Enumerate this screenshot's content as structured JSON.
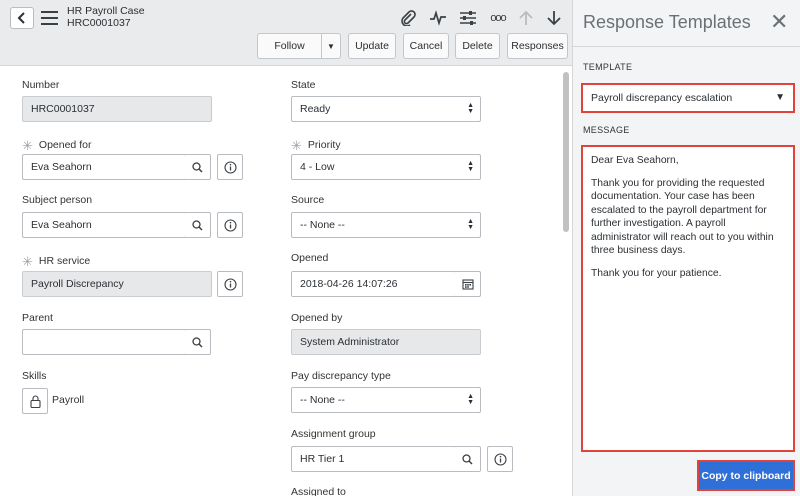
{
  "header": {
    "title": "HR Payroll Case",
    "number": "HRC0001037",
    "buttons": {
      "follow": "Follow",
      "update": "Update",
      "cancel": "Cancel",
      "delete": "Delete",
      "responses": "Responses"
    },
    "icons": [
      "back-icon",
      "menu-icon",
      "attachment-icon",
      "activity-icon",
      "settings-sliders-icon",
      "more-icon",
      "arrow-up-icon",
      "arrow-down-icon"
    ]
  },
  "form": {
    "number": {
      "label": "Number",
      "value": "HRC0001037"
    },
    "opened_for": {
      "label": "Opened for",
      "value": "Eva Seahorn"
    },
    "subject_person": {
      "label": "Subject person",
      "value": "Eva Seahorn"
    },
    "hr_service": {
      "label": "HR service",
      "value": "Payroll Discrepancy"
    },
    "parent": {
      "label": "Parent",
      "value": ""
    },
    "skills": {
      "label": "Skills",
      "value": "Payroll"
    },
    "state": {
      "label": "State",
      "value": "Ready"
    },
    "priority": {
      "label": "Priority",
      "value": "4 - Low"
    },
    "source": {
      "label": "Source",
      "value": "-- None --"
    },
    "opened": {
      "label": "Opened",
      "value": "2018-04-26 14:07:26"
    },
    "opened_by": {
      "label": "Opened by",
      "value": "System Administrator"
    },
    "pay_discrepancy_type": {
      "label": "Pay discrepancy type",
      "value": "-- None --"
    },
    "assignment_group": {
      "label": "Assignment group",
      "value": "HR Tier 1"
    },
    "assigned_to": {
      "label": "Assigned to"
    }
  },
  "panel": {
    "title": "Response Templates",
    "template_label": "TEMPLATE",
    "template_value": "Payroll discrepancy escalation",
    "message_label": "MESSAGE",
    "message": {
      "greeting": "Dear Eva Seahorn,",
      "body": "Thank you for providing the requested documentation. Your case has been escalated to the payroll department for further investigation. A payroll administrator will reach out to you within three business days.",
      "closing": "Thank you for your patience."
    },
    "copy_button": "Copy to clipboard"
  },
  "colors": {
    "header_bg": "#e9ebec",
    "panel_bg": "#f3f4f5",
    "highlight_border": "#e0433a",
    "primary_button": "#2f6fd8",
    "readonly_field": "#e6e8ea"
  }
}
